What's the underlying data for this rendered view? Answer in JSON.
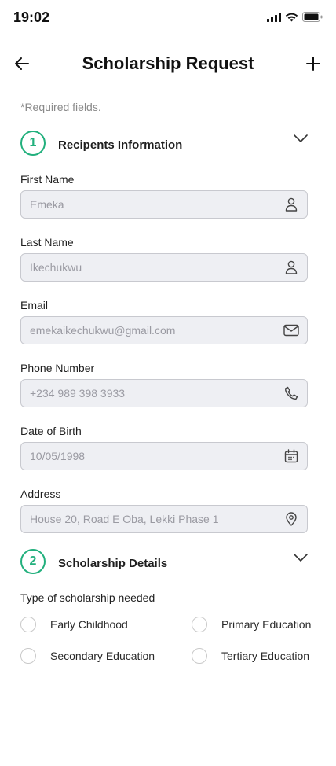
{
  "status_bar": {
    "time": "19:02"
  },
  "header": {
    "title": "Scholarship Request"
  },
  "required_note": "*Required fields.",
  "sections": [
    {
      "number": "1",
      "title": "Recipents Information"
    },
    {
      "number": "2",
      "title": "Scholarship Details"
    }
  ],
  "fields": {
    "first_name": {
      "label": "First Name",
      "placeholder": "Emeka"
    },
    "last_name": {
      "label": "Last Name",
      "placeholder": "Ikechukwu"
    },
    "email": {
      "label": "Email",
      "placeholder": "emekaikechukwu@gmail.com"
    },
    "phone": {
      "label": "Phone Number",
      "placeholder": "+234 989 398 3933"
    },
    "dob": {
      "label": "Date of Birth",
      "placeholder": "10/05/1998"
    },
    "address": {
      "label": "Address",
      "placeholder": "House 20, Road E Oba, Lekki Phase 1"
    }
  },
  "scholarship": {
    "question": "Type of scholarship needed",
    "options": [
      "Early Childhood",
      "Primary Education",
      "Secondary Education",
      "Tertiary Education"
    ]
  },
  "colors": {
    "accent": "#22b07d",
    "field_bg": "#eeeff3",
    "field_border": "#c8c9cf"
  }
}
